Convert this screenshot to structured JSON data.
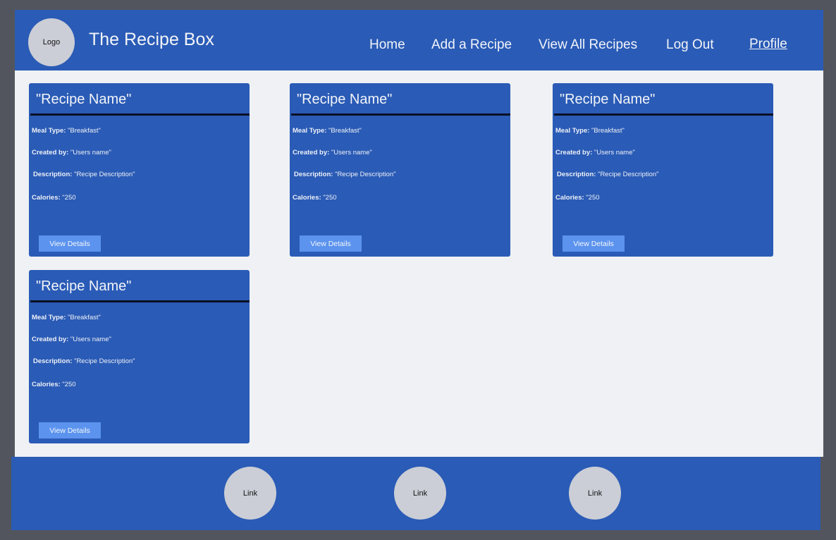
{
  "header": {
    "logo_label": "Logo",
    "title": "The Recipe Box",
    "nav": [
      "Home",
      "Add a Recipe",
      "View All Recipes",
      "Log Out"
    ],
    "profile": "Profile"
  },
  "cards": [
    {
      "title": "\"Recipe Name\"",
      "meal_type_label": "Meal Type:",
      "meal_type": " \"Breakfast\"",
      "created_by_label": "Created by:",
      "created_by": " \"Users name\"",
      "description_label": "Description:",
      "description": " \"Recipe Description\"",
      "calories_label": "Calories:",
      "calories": " \"250",
      "button": "View Details"
    },
    {
      "title": "\"Recipe Name\"",
      "meal_type_label": "Meal Type:",
      "meal_type": " \"Breakfast\"",
      "created_by_label": "Created by:",
      "created_by": " \"Users name\"",
      "description_label": "Description:",
      "description": " \"Recipe Description\"",
      "calories_label": "Calories:",
      "calories": " \"250",
      "button": "View Details"
    },
    {
      "title": "\"Recipe Name\"",
      "meal_type_label": "Meal Type:",
      "meal_type": " \"Breakfast\"",
      "created_by_label": "Created by:",
      "created_by": " \"Users name\"",
      "description_label": "Description:",
      "description": " \"Recipe Description\"",
      "calories_label": "Calories:",
      "calories": " \"250",
      "button": "View Details"
    },
    {
      "title": "\"Recipe Name\"",
      "meal_type_label": "Meal Type:",
      "meal_type": " \"Breakfast\"",
      "created_by_label": "Created by:",
      "created_by": " \"Users name\"",
      "description_label": "Description:",
      "description": " \"Recipe Description\"",
      "calories_label": "Calories:",
      "calories": " \"250",
      "button": "View Details"
    }
  ],
  "footer": {
    "links": [
      "Link",
      "Link",
      "Link"
    ]
  },
  "colors": {
    "primary": "#2a5bb6",
    "button": "#5b93ee",
    "background": "#eff1f4",
    "outer": "#52555d",
    "circle": "#cbced6"
  }
}
